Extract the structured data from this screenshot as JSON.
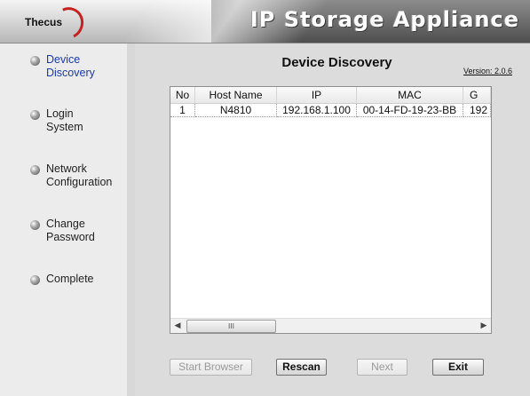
{
  "header": {
    "logo_text": "Thecus",
    "app_title": "IP Storage Appliance"
  },
  "sidebar": {
    "items": [
      {
        "label": "Device\nDiscovery",
        "active": true
      },
      {
        "label": "Login\nSystem",
        "active": false
      },
      {
        "label": "Network\nConfiguration",
        "active": false
      },
      {
        "label": "Change\nPassword",
        "active": false
      },
      {
        "label": "Complete",
        "active": false
      }
    ]
  },
  "main": {
    "title": "Device Discovery",
    "version": "Version: 2.0.6"
  },
  "table": {
    "columns": [
      "No",
      "Host Name",
      "IP",
      "MAC",
      "G"
    ],
    "rows": [
      [
        "1",
        "N4810",
        "192.168.1.100",
        "00-14-FD-19-23-BB",
        "192"
      ]
    ],
    "scroll_thumb_glyph": "III"
  },
  "buttons": {
    "start_browser": "Start Browser",
    "rescan": "Rescan",
    "next": "Next",
    "exit": "Exit"
  },
  "colors": {
    "active_nav": "#1a3aa8",
    "logo_ring": "#c62020"
  }
}
